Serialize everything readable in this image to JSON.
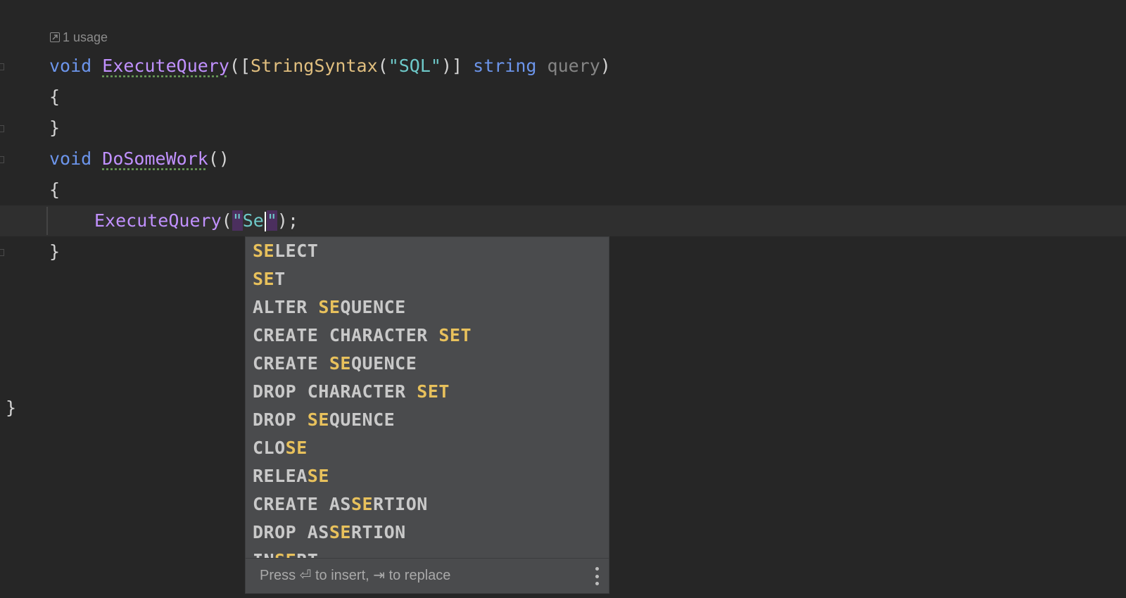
{
  "usage_hint": {
    "text": "1 usage",
    "icon": "external-link-icon"
  },
  "code": {
    "line1": {
      "kw_void": "void",
      "method": "ExecuteQuery",
      "open": "([",
      "attr": "StringSyntax",
      "attr_open": "(",
      "attr_str": "\"SQL\"",
      "attr_close": ")]",
      "type": "string",
      "param": "query",
      "close": ")"
    },
    "line2": "{",
    "line3": "}",
    "line4": {
      "kw_void": "void",
      "method": "DoSomeWork",
      "parens": "()"
    },
    "line5": "{",
    "line6": {
      "method": "ExecuteQuery",
      "open": "(",
      "quote_open": "\"",
      "typed": "Se",
      "quote_close": "\"",
      "close": ");"
    },
    "line7": "}",
    "outer_close": "}"
  },
  "completion": {
    "items": [
      {
        "before": "",
        "match": "SE",
        "after": "LECT"
      },
      {
        "before": "",
        "match": "SE",
        "after": "T"
      },
      {
        "before": "ALTER ",
        "match": "SE",
        "after": "QUENCE"
      },
      {
        "before": "CREATE CHARACTER ",
        "match": "SET",
        "after": ""
      },
      {
        "before": "CREATE ",
        "match": "SE",
        "after": "QUENCE"
      },
      {
        "before": "DROP CHARACTER ",
        "match": "SET",
        "after": ""
      },
      {
        "before": "DROP ",
        "match": "SE",
        "after": "QUENCE"
      },
      {
        "before": "CLO",
        "match": "SE",
        "after": ""
      },
      {
        "before": "RELEA",
        "match": "SE",
        "after": ""
      },
      {
        "before": "CREATE AS",
        "match": "SE",
        "after": "RTION"
      },
      {
        "before": "DROP AS",
        "match": "SE",
        "after": "RTION"
      },
      {
        "before": "IN",
        "match": "SE",
        "after": "RT"
      }
    ],
    "footer": "Press ⏎ to insert, ⇥ to replace",
    "more_icon": "more-vertical-icon"
  },
  "colors": {
    "background": "#262626",
    "keyword": "#6c95eb",
    "method": "#c191ff",
    "attribute": "#e1bf7f",
    "string": "#6ec9c9",
    "match_highlight": "#e8c15c",
    "popup_background": "#4a4b4d"
  }
}
